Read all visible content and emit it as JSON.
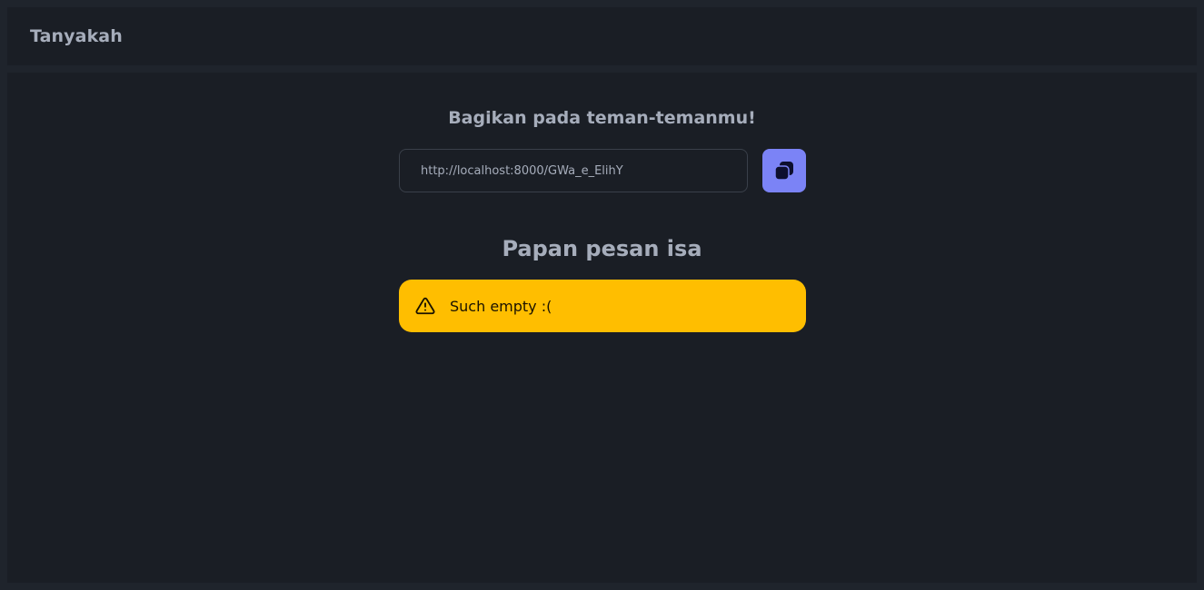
{
  "app": {
    "title": "Tanyakah"
  },
  "share": {
    "heading": "Bagikan pada teman-temanmu!",
    "url_value": "http://localhost:8000/GWa_e_ElihY",
    "copy_icon": "copy-icon"
  },
  "board": {
    "heading": "Papan pesan isa",
    "empty_alert": {
      "icon": "warning-icon",
      "text": "Such empty :("
    }
  },
  "colors": {
    "background": "#1a1e25",
    "text": "#a6adbb",
    "primary": "#7b83f6",
    "warning": "#ffbe00"
  }
}
